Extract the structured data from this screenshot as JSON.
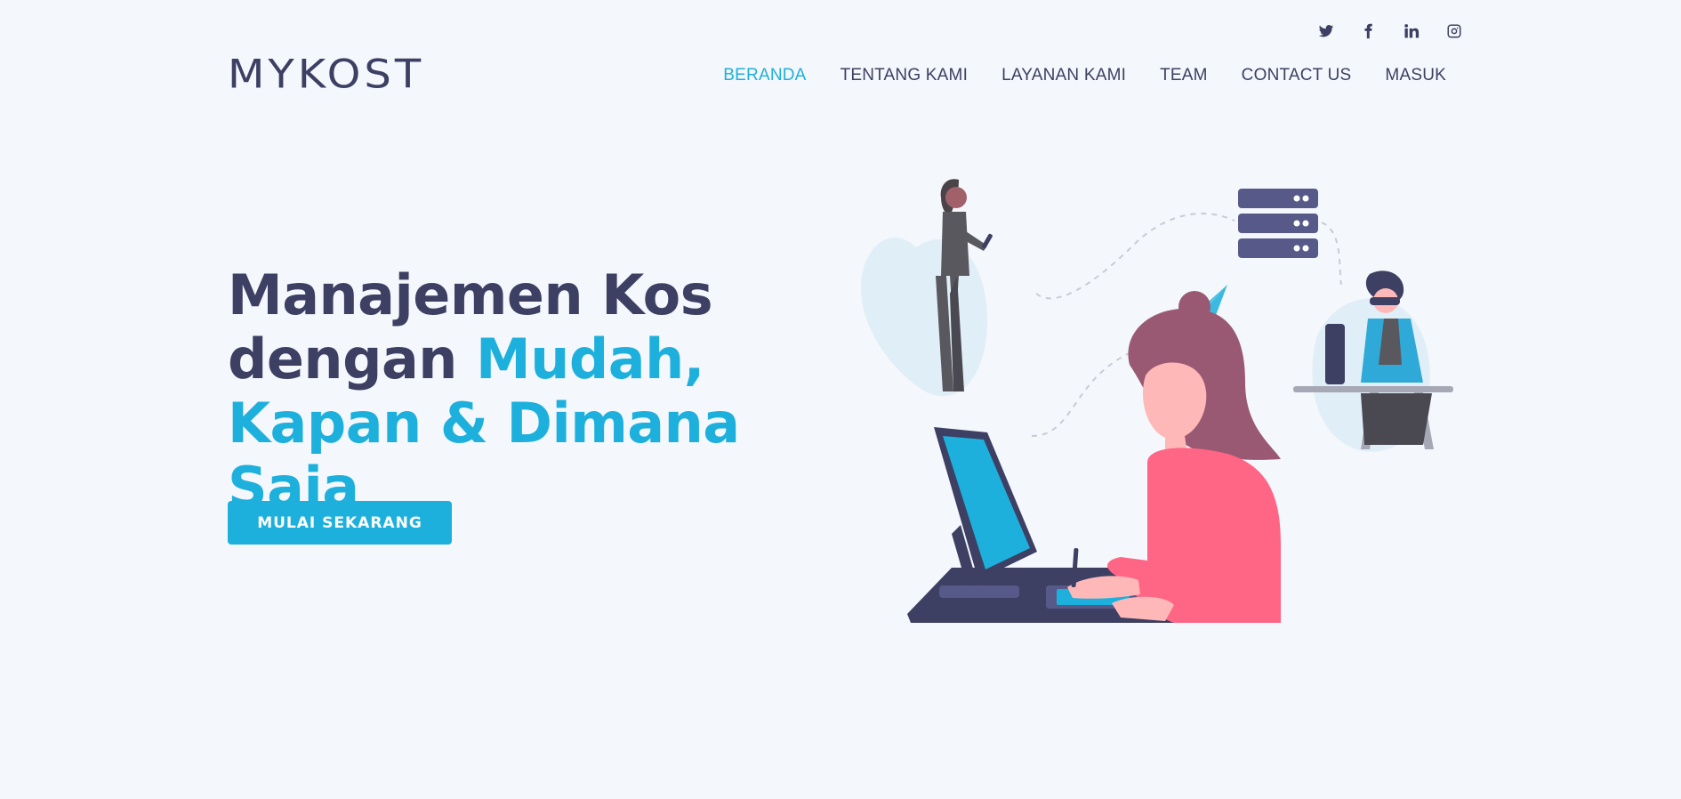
{
  "brand": {
    "name": "MYKOST"
  },
  "social": [
    {
      "icon": "twitter-icon"
    },
    {
      "icon": "facebook-icon"
    },
    {
      "icon": "linkedin-icon"
    },
    {
      "icon": "instagram-icon"
    }
  ],
  "nav": {
    "items": [
      {
        "label": "BERANDA",
        "active": true
      },
      {
        "label": "TENTANG KAMI"
      },
      {
        "label": "LAYANAN KAMI"
      },
      {
        "label": "TEAM"
      },
      {
        "label": "CONTACT US"
      },
      {
        "label": "MASUK"
      }
    ]
  },
  "hero": {
    "line1": "Manajemen Kos",
    "line2_plain": "dengan",
    "line2_accent": "Mudah,",
    "line3_accent": "Kapan & Dimana Saja",
    "cta_label": "MULAI SEKARANG"
  },
  "colors": {
    "accent": "#1eb0dc",
    "text": "#3d3f63",
    "background": "#f4f7fb",
    "pink": "#ff6584"
  }
}
